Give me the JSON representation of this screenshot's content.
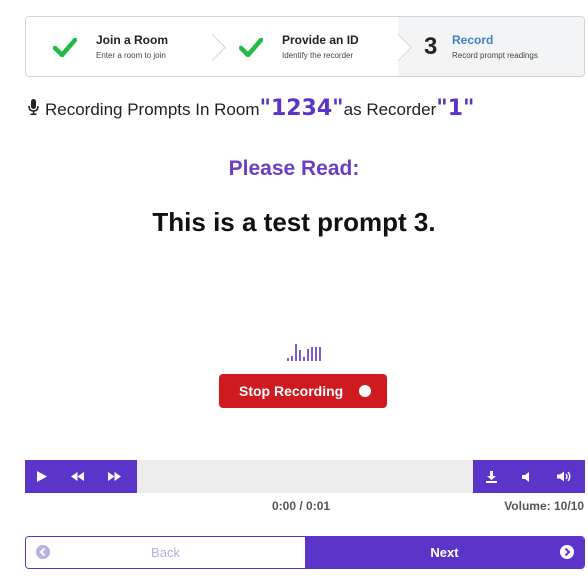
{
  "steps": [
    {
      "title": "Join a Room",
      "desc": "Enter a room to join",
      "status": "done",
      "icon": "check-icon"
    },
    {
      "title": "Provide an ID",
      "desc": "Identify the recorder",
      "status": "done",
      "icon": "check-icon"
    },
    {
      "title": "Record",
      "desc": "Record prompt readings",
      "status": "active",
      "number": "3"
    }
  ],
  "heading": {
    "prefix": "Recording Prompts In Room",
    "room": "\"1234\"",
    "middle": "as Recorder",
    "recorder": "\"1\"",
    "icon": "microphone-icon"
  },
  "please_read": "Please Read:",
  "prompt": "This is a test prompt 3.",
  "stop_button": "Stop Recording",
  "player": {
    "time": "0:00 / 0:01",
    "volume": "Volume: 10/10",
    "left_icons": [
      "play-icon",
      "rewind-icon",
      "fast-forward-icon"
    ],
    "right_icons": [
      "download-icon",
      "volume-down-icon",
      "volume-up-icon"
    ]
  },
  "nav": {
    "back": "Back",
    "next": "Next"
  },
  "colors": {
    "accent": "#5b34c9",
    "stop": "#d01a1f",
    "check": "#21ba45",
    "active_step": "#4183c4"
  }
}
